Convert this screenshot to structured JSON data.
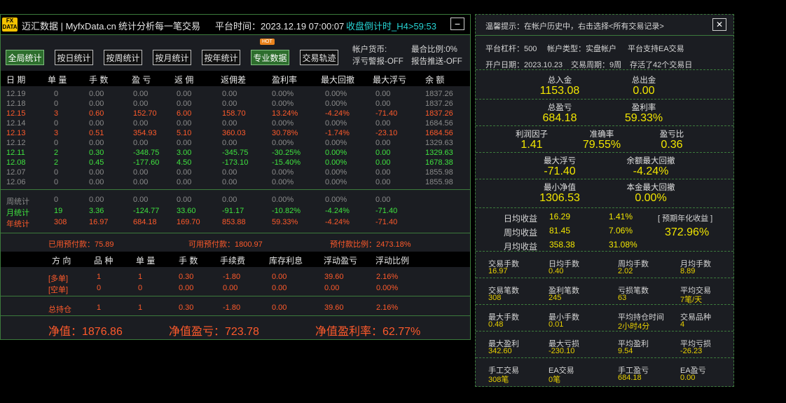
{
  "left": {
    "logo": [
      "FX",
      "DATA"
    ],
    "brand": "迈汇数据 | MyfxData.cn",
    "slogan": "统计分析每一笔交易",
    "platform_time": "平台时间：2023.12.19 07:00:07",
    "countdown": "收盘倒计时_H4>59:53",
    "minimize": "−",
    "hot_badge": "HOT",
    "buttons": [
      "全局统计",
      "按日统计",
      "按周统计",
      "按月统计",
      "按年统计",
      "专业数据",
      "交易轨迹"
    ],
    "account_currency": "帐户货币:",
    "margin_ratio": "最合比例:0%",
    "float_alert": "浮亏警报-OFF",
    "report_push": "报告推送-OFF",
    "headers": [
      "日 期",
      "单 量",
      "手 数",
      "盈 亏",
      "返 佣",
      "返佣差",
      "盈利率",
      "最大回撤",
      "最大浮亏",
      "余 额"
    ],
    "daily": [
      {
        "c": "gray",
        "v": [
          "12.19",
          "0",
          "0.00",
          "0.00",
          "0.00",
          "0.00",
          "0.00%",
          "0.00%",
          "0.00",
          "1837.26"
        ]
      },
      {
        "c": "gray",
        "v": [
          "12.18",
          "0",
          "0.00",
          "0.00",
          "0.00",
          "0.00",
          "0.00%",
          "0.00%",
          "0.00",
          "1837.26"
        ]
      },
      {
        "c": "red",
        "v": [
          "12.15",
          "3",
          "0.60",
          "152.70",
          "6.00",
          "158.70",
          "13.24%",
          "-4.24%",
          "-71.40",
          "1837.26"
        ]
      },
      {
        "c": "gray",
        "v": [
          "12.14",
          "0",
          "0.00",
          "0.00",
          "0.00",
          "0.00",
          "0.00%",
          "0.00%",
          "0.00",
          "1684.56"
        ]
      },
      {
        "c": "red",
        "v": [
          "12.13",
          "3",
          "0.51",
          "354.93",
          "5.10",
          "360.03",
          "30.78%",
          "-1.74%",
          "-23.10",
          "1684.56"
        ]
      },
      {
        "c": "gray",
        "v": [
          "12.12",
          "0",
          "0.00",
          "0.00",
          "0.00",
          "0.00",
          "0.00%",
          "0.00%",
          "0.00",
          "1329.63"
        ]
      },
      {
        "c": "green",
        "v": [
          "12.11",
          "2",
          "0.30",
          "-348.75",
          "3.00",
          "-345.75",
          "-30.25%",
          "0.00%",
          "0.00",
          "1329.63"
        ]
      },
      {
        "c": "green",
        "v": [
          "12.08",
          "2",
          "0.45",
          "-177.60",
          "4.50",
          "-173.10",
          "-15.40%",
          "0.00%",
          "0.00",
          "1678.38"
        ]
      },
      {
        "c": "gray",
        "v": [
          "12.07",
          "0",
          "0.00",
          "0.00",
          "0.00",
          "0.00",
          "0.00%",
          "0.00%",
          "0.00",
          "1855.98"
        ]
      },
      {
        "c": "gray",
        "v": [
          "12.06",
          "0",
          "0.00",
          "0.00",
          "0.00",
          "0.00",
          "0.00%",
          "0.00%",
          "0.00",
          "1855.98"
        ]
      }
    ],
    "summary": [
      {
        "c": "gray",
        "v": [
          "周统计",
          "0",
          "0.00",
          "0.00",
          "0.00",
          "0.00",
          "0.00%",
          "0.00%",
          "0.00"
        ]
      },
      {
        "c": "green",
        "v": [
          "月统计",
          "19",
          "3.36",
          "-124.77",
          "33.60",
          "-91.17",
          "-10.82%",
          "-4.24%",
          "-71.40"
        ]
      },
      {
        "c": "red",
        "v": [
          "年统计",
          "308",
          "16.97",
          "684.18",
          "169.70",
          "853.88",
          "59.33%",
          "-4.24%",
          "-71.40"
        ]
      }
    ],
    "margin_used": "已用预付款：75.89",
    "margin_free": "可用预付款：1800.97",
    "margin_ratio_val": "预付款比例：2473.18%",
    "pos_headers": [
      "方 向",
      "品 种",
      "单 量",
      "手 数",
      "手续费",
      "库存利息",
      "浮动盈亏",
      "浮动比例"
    ],
    "positions": [
      {
        "c": "red",
        "v": [
          "[多单]",
          "1",
          "1",
          "0.30",
          "-1.80",
          "0.00",
          "39.60",
          "2.16%"
        ]
      },
      {
        "c": "red",
        "v": [
          "[空单]",
          "0",
          "0",
          "0.00",
          "0.00",
          "0.00",
          "0.00",
          "0.00%"
        ]
      }
    ],
    "total": {
      "c": "red",
      "v": [
        "总持仓",
        "1",
        "1",
        "0.30",
        "-1.80",
        "0.00",
        "39.60",
        "2.16%"
      ]
    },
    "equity": "净值：1876.86",
    "equity_pl": "净值盈亏：723.78",
    "equity_rate": "净值盈利率：62.77%"
  },
  "right": {
    "tip": "温馨提示：在帐户历史中，右击选择<所有交易记录>",
    "close": "✕",
    "leverage": "平台杠杆：500",
    "account_type": "帐户类型：实盘帐户",
    "ea_support": "平台支持EA交易",
    "open_date": "开户日期：2023.10.23",
    "period": "交易周期：9周",
    "stored": "存活了42个交易日",
    "deposit_lbl": "总入金",
    "deposit": "1153.08",
    "withdraw_lbl": "总出金",
    "withdraw": "0.00",
    "pl_lbl": "总盈亏",
    "pl": "684.18",
    "rate_lbl": "盈利率",
    "rate": "59.33%",
    "pf_lbl": "利润因子",
    "pf": "1.41",
    "acc_lbl": "准确率",
    "acc": "79.55%",
    "rr_lbl": "盈亏比",
    "rr": "0.36",
    "maxfl_lbl": "最大浮亏",
    "maxfl": "-71.40",
    "maxdd_lbl": "余额最大回撤",
    "maxdd": "-4.24%",
    "mineq_lbl": "最小净值",
    "mineq": "1306.53",
    "capdd_lbl": "本金最大回撤",
    "capdd": "0.00%",
    "daily_lbl": "日均收益",
    "daily_v": "16.29",
    "daily_p": "1.41%",
    "weekly_lbl": "周均收益",
    "weekly_v": "81.45",
    "weekly_p": "7.06%",
    "monthly_lbl": "月均收益",
    "monthly_v": "358.38",
    "monthly_p": "31.08%",
    "annual_lbl": "[ 预期年化收益 ]",
    "annual": "372.96%",
    "grid": [
      [
        [
          "交易手数",
          "16.97"
        ],
        [
          "日均手数",
          "0.40"
        ],
        [
          "周均手数",
          "2.02"
        ],
        [
          "月均手数",
          "8.89"
        ]
      ],
      [
        [
          "交易笔数",
          "308"
        ],
        [
          "盈利笔数",
          "245"
        ],
        [
          "亏损笔数",
          "63"
        ],
        [
          "平均交易",
          "7笔/天"
        ]
      ],
      [
        [
          "最大手数",
          "0.48"
        ],
        [
          "最小手数",
          "0.01"
        ],
        [
          "平均持仓时间",
          "2小时4分"
        ],
        [
          "交易品种",
          "4"
        ]
      ],
      [
        [
          "最大盈利",
          "342.60"
        ],
        [
          "最大亏损",
          "-230.10"
        ],
        [
          "平均盈利",
          "9.54"
        ],
        [
          "平均亏损",
          "-26.23"
        ]
      ],
      [
        [
          "手工交易",
          "308笔"
        ],
        [
          "EA交易",
          "0笔"
        ],
        [
          "手工盈亏",
          "684.18"
        ],
        [
          "EA盈亏",
          "0.00"
        ]
      ]
    ]
  },
  "colors": {
    "red": "#ff5a2b",
    "green": "#3fe23f",
    "yellow": "#f2e600",
    "cyan": "#27d3d3",
    "border": "#3c7a3c"
  }
}
